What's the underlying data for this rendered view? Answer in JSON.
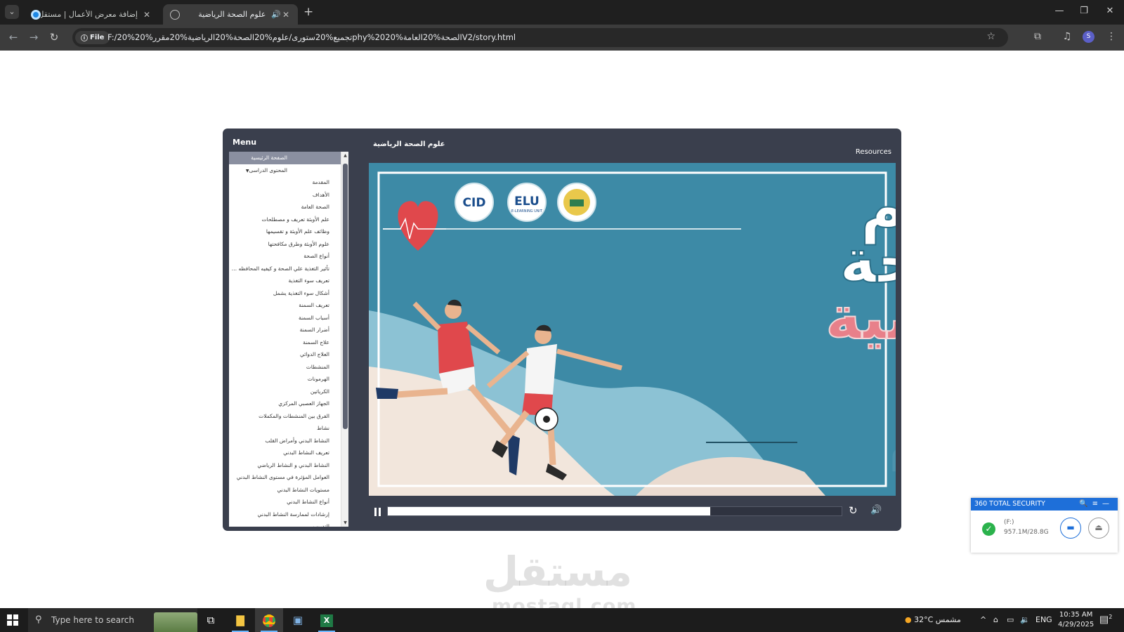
{
  "browser": {
    "tabs": [
      {
        "title": "إضافة معرض الأعمال | مستقل",
        "active": false
      },
      {
        "title": "علوم الصحة الرياضية",
        "active": true
      }
    ],
    "address": {
      "scheme_label": "File",
      "url": "F:/20%تجميع%20ستورى/علوم%20الصحة%20الرياضية%20مقرر%20phy%20الصحة%20العامة%20V2/story.html"
    },
    "profile_initial": "S"
  },
  "player": {
    "menu_label": "Menu",
    "course_title": "علوم الصحة الرياضية",
    "resources_label": "Resources",
    "menu_items": [
      {
        "label": "الصفحة الرئيسية",
        "level": 0,
        "selected": true
      },
      {
        "label": "المحتوى الدراسى",
        "level": 0,
        "selected": false,
        "expanded": true
      },
      {
        "label": "المقدمة",
        "level": 1
      },
      {
        "label": "الأهداف",
        "level": 1
      },
      {
        "label": "الصحة العامة",
        "level": 1
      },
      {
        "label": "علم الأوبئة تعريف و مصطلحات",
        "level": 1
      },
      {
        "label": "وظائف علم الأوبئة و تقسيمها",
        "level": 1
      },
      {
        "label": "علوم الأوبئة وطرق مكافحتها",
        "level": 1
      },
      {
        "label": "أنواع الصحة",
        "level": 1
      },
      {
        "label": "تأثير التغذية علي الصحة و كيفيه المحافظه علي الصحه",
        "level": 1
      },
      {
        "label": "تعريف سوء التغذية",
        "level": 1
      },
      {
        "label": "أشكال سوء التغذية يشمل",
        "level": 1
      },
      {
        "label": "تعريف السمنة",
        "level": 1
      },
      {
        "label": "أسباب السمنة",
        "level": 1
      },
      {
        "label": "أضرار السمنة",
        "level": 1
      },
      {
        "label": "علاج السمنة",
        "level": 1
      },
      {
        "label": "العلاج الدوائي",
        "level": 1
      },
      {
        "label": "المنشطات",
        "level": 1
      },
      {
        "label": "الهرمونات",
        "level": 1
      },
      {
        "label": "الكرياتين",
        "level": 1
      },
      {
        "label": "الجهاز العصبي المركزي",
        "level": 1
      },
      {
        "label": "الفرق بين المنشطات والمكملات",
        "level": 1
      },
      {
        "label": "نشاط",
        "level": 1
      },
      {
        "label": "النشاط البدني وأمراض القلب",
        "level": 1
      },
      {
        "label": "تعريف النشاط البدني",
        "level": 1
      },
      {
        "label": "النشاط البدني و النشاط الرياضي",
        "level": 1
      },
      {
        "label": "العوامل المؤثرة في مستوى النشاط البدني",
        "level": 1
      },
      {
        "label": "مستويات النشاط البدني",
        "level": 1
      },
      {
        "label": "أنواع النشاط البدني",
        "level": 1
      },
      {
        "label": "إرشادات لممارسة النشاط البدني",
        "level": 1
      },
      {
        "label": "التدريب",
        "level": 1
      }
    ],
    "slide": {
      "title_line1": "علوم",
      "title_line2": "الصحة",
      "title_line3": "الرياضية",
      "logos": [
        {
          "text": "CID",
          "name": "cid-logo"
        },
        {
          "text": "ELU",
          "sub": "E-LEARNING UNIT",
          "name": "elu-logo"
        },
        {
          "text": "",
          "name": "university-logo"
        }
      ],
      "colors": {
        "background": "#3d8aa6",
        "title_white": "#ffffff",
        "title_pink": "#e8808a",
        "heart": "#e0484c"
      }
    },
    "progress": 0.71
  },
  "security_popup": {
    "title": "360 TOTAL SECURITY",
    "drive": "(F:)",
    "size": "957.1M/28.8G"
  },
  "watermark": {
    "arabic": "مستقل",
    "latin": "mostaql.com"
  },
  "taskbar": {
    "search_placeholder": "Type here to search",
    "temperature": "32°C",
    "weather": "مشمس",
    "language": "ENG",
    "time": "10:35 AM",
    "date": "4/29/2025",
    "notifications": "2"
  }
}
